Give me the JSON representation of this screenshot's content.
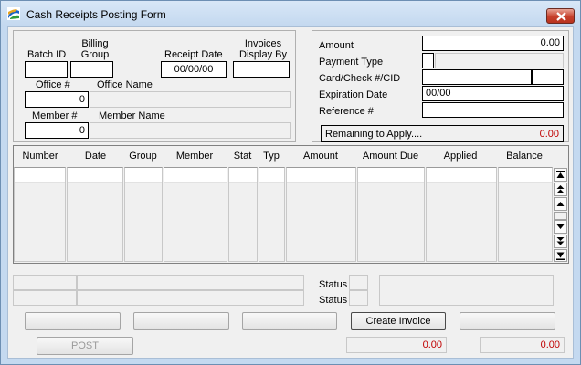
{
  "window": {
    "title": "Cash Receipts Posting Form"
  },
  "left_panel": {
    "batch_id_label": "Batch ID",
    "billing_group_label": "Billing\nGroup",
    "receipt_date_label": "Receipt Date",
    "invoices_display_by_label": "Invoices\nDisplay By",
    "receipt_date_value": "00/00/00",
    "office_no_label": "Office #",
    "office_no_value": "0",
    "office_name_label": "Office Name",
    "member_no_label": "Member #",
    "member_no_value": "0",
    "member_name_label": "Member Name"
  },
  "right_panel": {
    "amount_label": "Amount",
    "amount_value": "0.00",
    "payment_type_label": "Payment Type",
    "card_check_label": "Card/Check #/CID",
    "expiration_date_label": "Expiration Date",
    "expiration_date_value": "00/00",
    "reference_label": "Reference #",
    "remaining_label": "Remaining to Apply....",
    "remaining_value": "0.00"
  },
  "grid": {
    "columns": [
      "Number",
      "Date",
      "Group",
      "Member",
      "Stat",
      "Typ",
      "Amount",
      "Amount Due",
      "Applied",
      "Balance"
    ]
  },
  "status": {
    "status1_label": "Status",
    "status2_label": "Status"
  },
  "buttons": {
    "create_invoice": "Create Invoice",
    "post": "POST"
  },
  "totals": {
    "total1": "0.00",
    "total2": "0.00"
  },
  "colors": {
    "title_gradient_top": "#d8e7f7",
    "client_bg": "#f0f0f0",
    "negative_red": "#c00000",
    "close_button": "#c7412c"
  }
}
